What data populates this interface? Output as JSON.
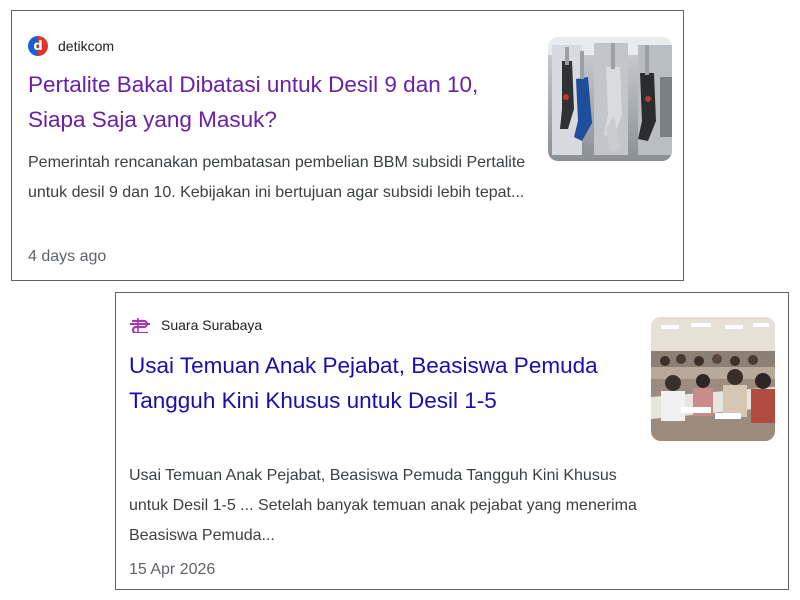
{
  "results": [
    {
      "source": {
        "name": "detikcom",
        "icon": "detik-logo-icon",
        "logo_letter": "d"
      },
      "title": "Pertalite Bakal Dibatasi untuk Desil 9 dan 10, Siapa Saja yang Masuk?",
      "snippet": "Pemerintah rencanakan pembatasan pembelian BBM subsidi Pertalite untuk desil 9 dan 10. Kebijakan ini bertujuan agar subsidi lebih tepat...",
      "date": "4 days ago",
      "thumbnail": "fuel-pump-nozzles-photo",
      "title_color": "#6a1fa7"
    },
    {
      "source": {
        "name": "Suara Surabaya",
        "icon": "suara-surabaya-logo-icon"
      },
      "title": "Usai Temuan Anak Pejabat, Beasiswa Pemuda Tangguh Kini Khusus untuk Desil 1-5",
      "snippet": "Usai Temuan Anak Pejabat, Beasiswa Pemuda Tangguh Kini Khusus untuk Desil 1-5 ... Setelah banyak temuan anak pejabat yang menerima Beasiswa Pemuda...",
      "date": "15 Apr 2026",
      "thumbnail": "crowded-registration-hall-photo",
      "title_color": "#1a0dab"
    }
  ]
}
